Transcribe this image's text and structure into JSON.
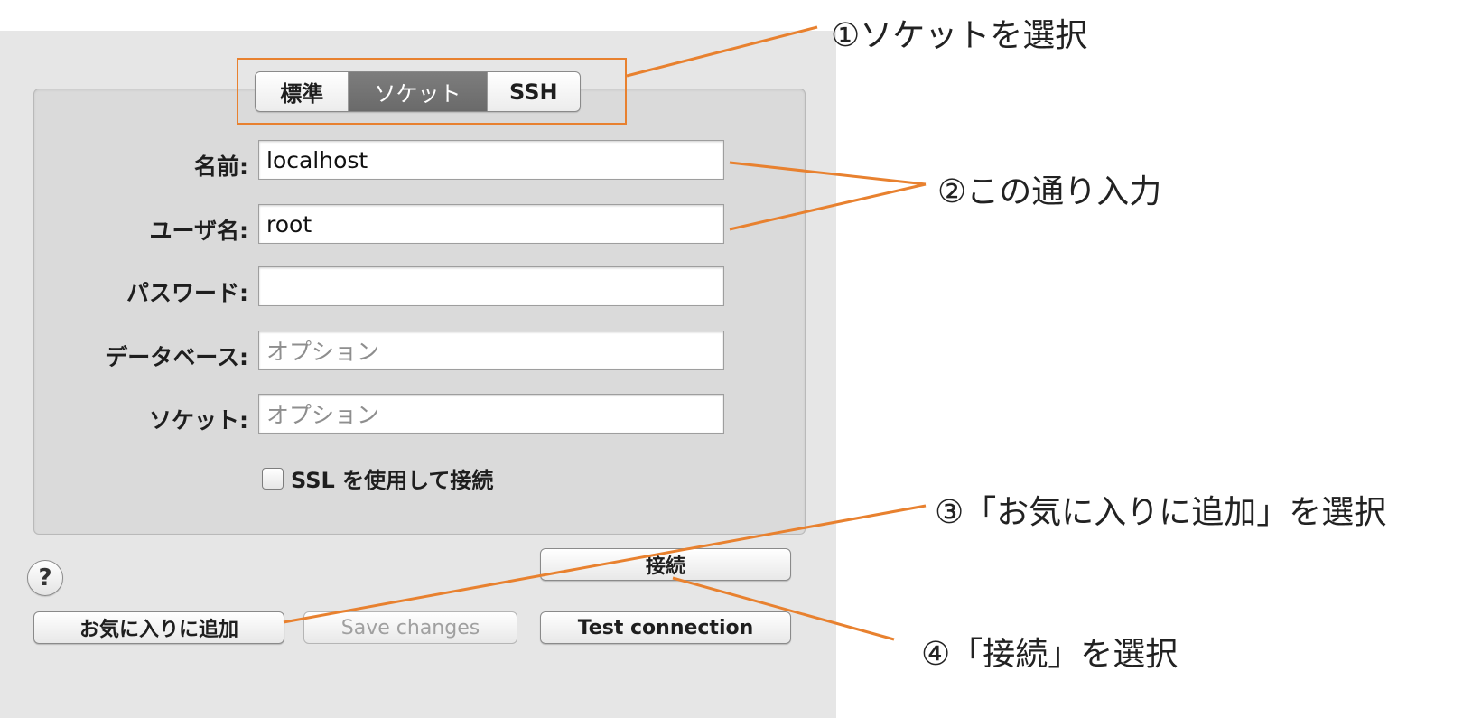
{
  "tabs": [
    {
      "label": "標準",
      "selected": false
    },
    {
      "label": "ソケット",
      "selected": true
    },
    {
      "label": "SSH",
      "selected": false
    }
  ],
  "form": {
    "name_label": "名前:",
    "name_value": "localhost",
    "user_label": "ユーザ名:",
    "user_value": "root",
    "password_label": "パスワード:",
    "password_value": "",
    "database_label": "データベース:",
    "database_placeholder": "オプション",
    "socket_label": "ソケット:",
    "socket_placeholder": "オプション",
    "ssl_label": "SSL を使用して接続",
    "ssl_checked": false
  },
  "buttons": {
    "help": "?",
    "connect": "接続",
    "add_favorite": "お気に入りに追加",
    "save_changes": "Save changes",
    "test_connection": "Test connection"
  },
  "annotations": {
    "step1": "①ソケットを選択",
    "step2": "②この通り入力",
    "step3": "③「お気に入りに追加」を選択",
    "step4": "④「接続」を選択"
  },
  "colors": {
    "annotation_line": "#e8812f",
    "panel_bg": "#e6e6e6",
    "selected_tab": "#737373"
  }
}
